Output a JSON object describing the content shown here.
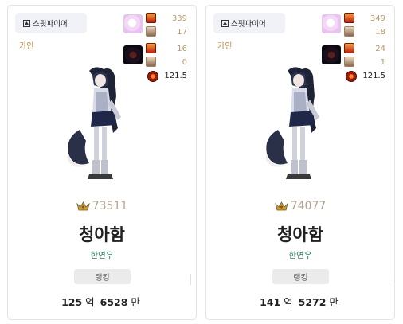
{
  "cards": [
    {
      "server": "스핏파이어",
      "job": "카인",
      "stats": [
        "339",
        "17",
        "16",
        "0"
      ],
      "orb_value": "121.5",
      "score": "73511",
      "name": "청아함",
      "guild": "한연우",
      "rank_label": "랭킹",
      "value": {
        "eok": "125",
        "eok_unit": "억",
        "man": "6528",
        "man_unit": "만"
      }
    },
    {
      "server": "스핏파이어",
      "job": "카인",
      "stats": [
        "349",
        "18",
        "24",
        "1"
      ],
      "orb_value": "121.5",
      "score": "74077",
      "name": "청아함",
      "guild": "한연우",
      "rank_label": "랭킹",
      "value": {
        "eok": "141",
        "eok_unit": "억",
        "man": "5272",
        "man_unit": "만"
      }
    }
  ],
  "icons": {
    "server": "server-icon",
    "crown": "crown-icon",
    "orb": "orb-icon"
  },
  "colors": {
    "job": "#b08a4a",
    "score": "#b5a390",
    "guild": "#2f7a5a"
  }
}
